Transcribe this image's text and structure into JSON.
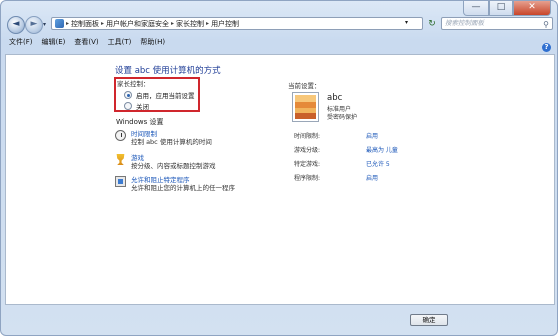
{
  "window": {
    "min": "—",
    "max": "□",
    "close": "✕"
  },
  "nav": {
    "back": "◄",
    "forward": "►",
    "history": "▾",
    "refresh": "↻",
    "breadcrumbs": [
      "控制面板",
      "用户帐户和家庭安全",
      "家长控制",
      "用户控制"
    ],
    "sep": "▸",
    "dropdown": "▾",
    "search_placeholder": "搜索控制面板",
    "search_icon": "⚲"
  },
  "menu": [
    "文件(F)",
    "编辑(E)",
    "查看(V)",
    "工具(T)",
    "帮助(H)"
  ],
  "help_icon": "?",
  "main": {
    "title": "设置 abc 使用计算机的方式",
    "pc_label": "家长控制：",
    "options": [
      {
        "label": "启用，应用当前设置",
        "selected": true
      },
      {
        "label": "关闭",
        "selected": false
      }
    ],
    "windows_settings": "Windows 设置",
    "items": [
      {
        "link": "时间限制",
        "desc": "控制 abc 使用计算机的时间",
        "icon": "clock-icon"
      },
      {
        "link": "游戏",
        "desc": "按分级、内容或标题控制游戏",
        "icon": "game-icon"
      },
      {
        "link": "允许和阻止特定程序",
        "desc": "允许和阻止您的计算机上的任一程序",
        "icon": "program-icon"
      }
    ]
  },
  "current": {
    "label": "当前设置：",
    "user": "abc",
    "role": "标准用户",
    "password": "受密码保护",
    "rows": [
      {
        "key": "时间限制:",
        "value": "启用"
      },
      {
        "key": "游戏分级:",
        "value": "最高为 儿童"
      },
      {
        "key": "特定游戏:",
        "value": "已允许 5"
      },
      {
        "key": "程序限制:",
        "value": "启用"
      }
    ]
  },
  "ok_button": "确定"
}
